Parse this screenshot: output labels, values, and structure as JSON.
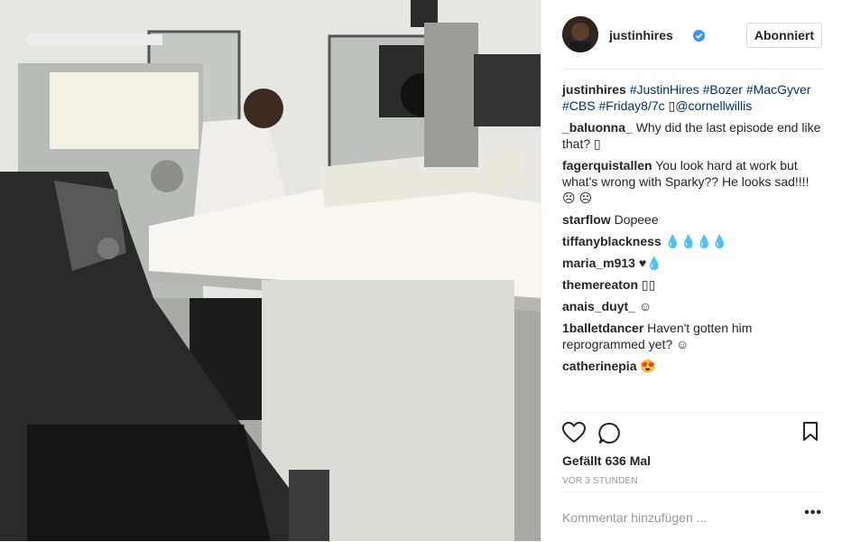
{
  "post": {
    "username": "justinhires",
    "follow_label": "Abonniert",
    "caption_user": "justinhires",
    "caption_tags": [
      "#JustinHires",
      "#Bozer",
      "#MacGyver",
      "#CBS",
      "#Friday8/7c"
    ],
    "caption_mention": "@cornellwillis",
    "caption_glyph": "▯"
  },
  "comments": [
    {
      "user": "_baluonna_",
      "text": "Why did the last episode end like that? ▯"
    },
    {
      "user": "fagerquistallen",
      "text": "You look hard at work but what's wrong with Sparky?? He looks sad!!!! ☹ ☹"
    },
    {
      "user": "starflow",
      "text": "Dopeee"
    },
    {
      "user": "tiffanyblackness",
      "text": "💧💧💧💧"
    },
    {
      "user": "maria_m913",
      "text": "♥💧"
    },
    {
      "user": "themereaton",
      "text": "▯▯"
    },
    {
      "user": "anais_duyt_",
      "text": "☺"
    },
    {
      "user": "1balletdancer",
      "text": "Haven't gotten him reprogrammed yet? ☺"
    },
    {
      "user": "catherinepia",
      "text": "😍"
    }
  ],
  "likes_text": "Gefällt 636 Mal",
  "time_text": "VOR 3 STUNDEN",
  "comment_placeholder": "Kommentar hinzufügen ...",
  "more_label": "•••",
  "colors": {
    "accent": "#3897f0",
    "link": "#003569",
    "border": "#efefef",
    "muted": "#999999"
  },
  "icons": {
    "like": "heart-icon",
    "comment": "comment-icon",
    "save": "bookmark-icon",
    "verified": "verified-badge-icon",
    "more": "more-options-icon"
  }
}
